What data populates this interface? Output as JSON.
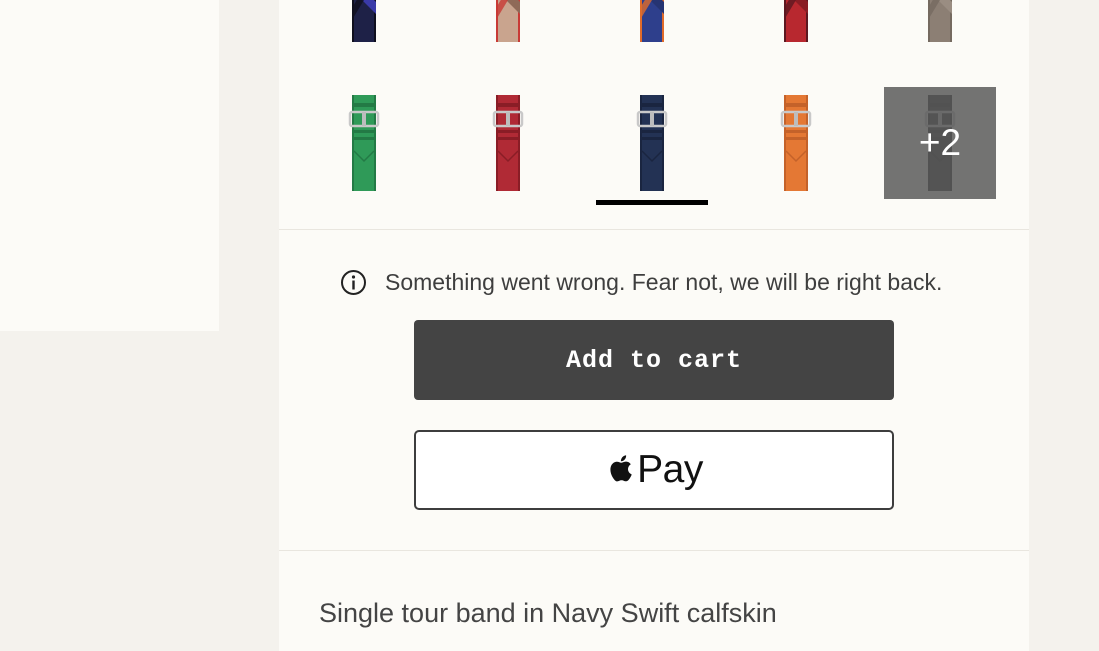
{
  "swatches_top": [
    {
      "name": "navy-black-band",
      "primary": "#1e2147",
      "secondary": "#0f0f1e",
      "accent": "#3a3aa8"
    },
    {
      "name": "beige-red-band",
      "primary": "#c9a48e",
      "secondary": "#c83a35",
      "accent": "#8f6a58"
    },
    {
      "name": "blue-orange-band",
      "primary": "#2e3f8c",
      "secondary": "#e06b2a",
      "accent": "#263472"
    },
    {
      "name": "red-burgundy-band",
      "primary": "#b8282f",
      "secondary": "#5c1820",
      "accent": "#8a1d24"
    },
    {
      "name": "taupe-band",
      "primary": "#8c7f74",
      "secondary": "#756a60",
      "accent": "#9a8d82"
    }
  ],
  "swatches_bottom": [
    {
      "name": "green-band",
      "primary": "#2f9a58",
      "secondary": "#237a45"
    },
    {
      "name": "rouge-band",
      "primary": "#b02a35",
      "secondary": "#8a1d26"
    },
    {
      "name": "navy-band",
      "primary": "#233254",
      "secondary": "#1a2540",
      "selected": true
    },
    {
      "name": "orange-band",
      "primary": "#e47834",
      "secondary": "#c4622a"
    },
    {
      "name": "gray-band",
      "primary": "#2e2e2e",
      "secondary": "#222222",
      "more_label": "+2"
    }
  ],
  "error": {
    "icon": "info-icon",
    "message": "Something went wrong. Fear not, we will be right back."
  },
  "actions": {
    "add_to_cart_label": "Add to cart",
    "apple_pay_label": "Pay"
  },
  "product": {
    "description": "Single tour band in Navy Swift calfskin"
  },
  "colors": {
    "button_dark": "#444444",
    "page_bg": "#f4f2ed",
    "panel_bg": "#fcfbf7"
  }
}
